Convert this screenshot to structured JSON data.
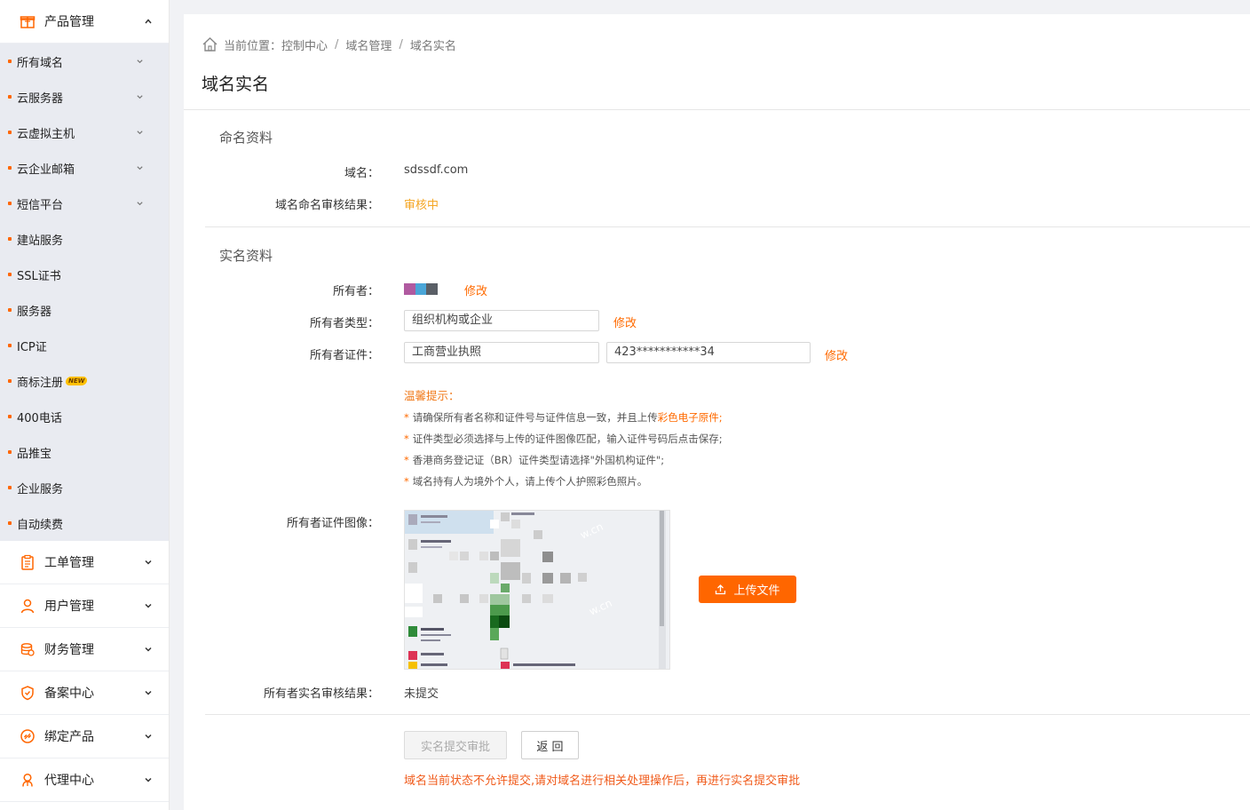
{
  "sidebar": {
    "product_group": {
      "label": "产品管理",
      "items": [
        {
          "label": "所有域名",
          "expandable": true
        },
        {
          "label": "云服务器",
          "expandable": true
        },
        {
          "label": "云虚拟主机",
          "expandable": true
        },
        {
          "label": "云企业邮箱",
          "expandable": true
        },
        {
          "label": "短信平台",
          "expandable": true
        },
        {
          "label": "建站服务",
          "expandable": false
        },
        {
          "label": "SSL证书",
          "expandable": false
        },
        {
          "label": "服务器",
          "expandable": false
        },
        {
          "label": "ICP证",
          "expandable": false
        },
        {
          "label": "商标注册",
          "expandable": false,
          "badge": "NEW"
        },
        {
          "label": "400电话",
          "expandable": false
        },
        {
          "label": "品推宝",
          "expandable": false
        },
        {
          "label": "企业服务",
          "expandable": false
        },
        {
          "label": "自动续费",
          "expandable": false
        }
      ]
    },
    "groups": [
      {
        "label": "工单管理",
        "icon": "clipboard-icon"
      },
      {
        "label": "用户管理",
        "icon": "user-icon"
      },
      {
        "label": "财务管理",
        "icon": "coins-icon"
      },
      {
        "label": "备案中心",
        "icon": "shield-icon"
      },
      {
        "label": "绑定产品",
        "icon": "link-icon"
      },
      {
        "label": "代理中心",
        "icon": "agent-icon"
      }
    ]
  },
  "breadcrumb": {
    "prefix": "当前位置：",
    "items": [
      "控制中心",
      "域名管理",
      "域名实名"
    ],
    "separator": "/"
  },
  "page": {
    "title": "域名实名"
  },
  "naming_section": {
    "title": "命名资料",
    "domain_label": "域名：",
    "domain_value": "sdssdf.com",
    "review_label": "域名命名审核结果：",
    "review_value": "审核中"
  },
  "realname_section": {
    "title": "实名资料",
    "owner_label": "所有者：",
    "owner_edit": "修改",
    "owner_type_label": "所有者类型：",
    "owner_type_value": "组织机构或企业",
    "owner_type_edit": "修改",
    "owner_cert_label": "所有者证件：",
    "cert_type_value": "工商营业执照",
    "cert_number_value": "423***********34",
    "cert_edit": "修改",
    "tips": {
      "title": "温馨提示：",
      "line1_a": "请确保所有者名称和证件号与证件信息一致，并且上传",
      "line1_hl": "彩色电子原件;",
      "line2": "证件类型必须选择与上传的证件图像匹配，输入证件号码后点击保存;",
      "line3": "香港商务登记证（BR）证件类型请选择\"外国机构证件\";",
      "line4": "域名持有人为境外个人，请上传个人护照彩色照片。",
      "star": "*"
    },
    "cert_image_label": "所有者证件图像：",
    "upload_label": "上传文件",
    "result_label": "所有者实名审核结果：",
    "result_value": "未提交"
  },
  "actions": {
    "submit_label": "实名提交审批",
    "back_label": "返 回",
    "warning": "域名当前状态不允许提交,请对域名进行相关处理操作后，再进行实名提交审批"
  },
  "colors": {
    "accent": "#ff6600",
    "review_status": "#f5a623",
    "warning": "#f05a1a",
    "submenu_bg": "#e9ebf1"
  }
}
